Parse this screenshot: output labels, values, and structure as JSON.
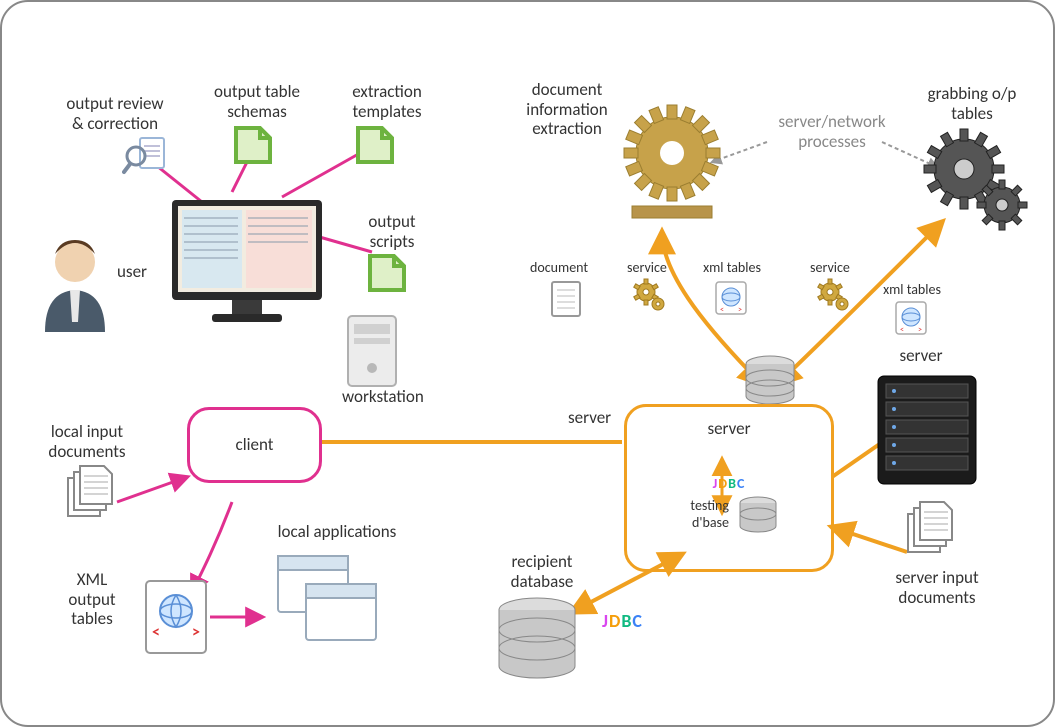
{
  "labels": {
    "output_review": "output review\n& correction",
    "output_table_schemas": "output table\nschemas",
    "extraction_templates": "extraction\ntemplates",
    "output_scripts": "output\nscripts",
    "user": "user",
    "workstation": "workstation",
    "client": "client",
    "local_input_documents": "local input\ndocuments",
    "xml_output_tables": "XML\noutput\ntables",
    "local_applications": "local applications",
    "document_information_extraction": "document\ninformation\nextraction",
    "server_network_processes": "server/network\nprocesses",
    "grabbing_op_tables": "grabbing o/p\ntables",
    "document": "document",
    "service1": "service",
    "xml_tables": "xml tables",
    "service2": "service",
    "xml_tables2": "xml tables",
    "server_left": "server",
    "server_inner": "server",
    "jdbc_inner": "JDBC",
    "testing_dbase": "testing\nd'base",
    "server_right": "server",
    "recipient_database": "recipient\ndatabase",
    "jdbc_outer": "JDBC",
    "server_input_documents": "server input\ndocuments"
  },
  "colors": {
    "pink": "#e0308f",
    "orange": "#f0a020",
    "gold": "#c7a24a",
    "green_doc": "#6db33f"
  }
}
